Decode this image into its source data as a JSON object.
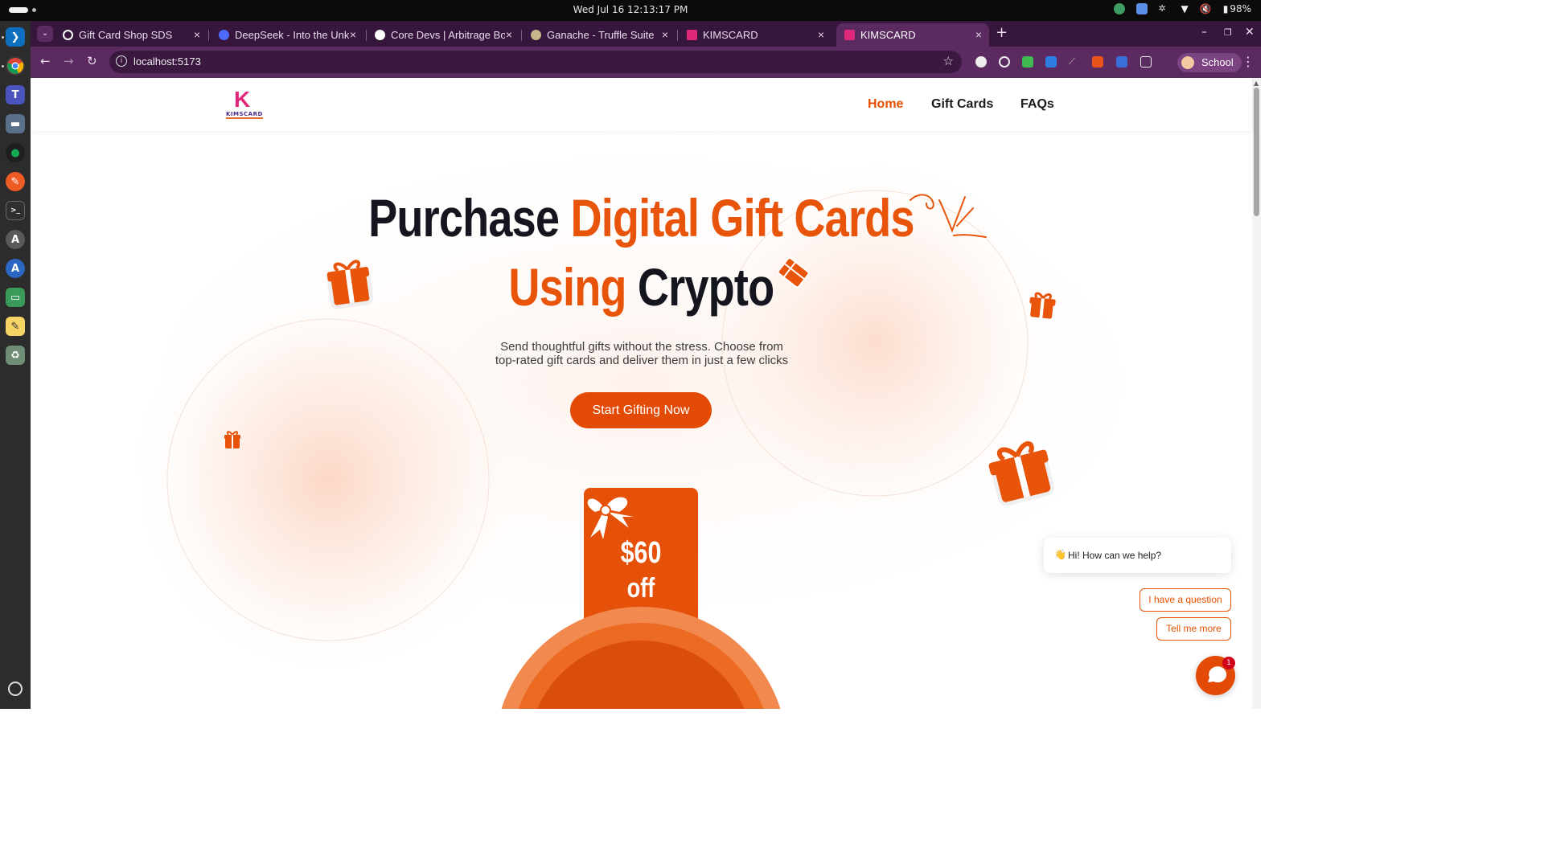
{
  "os": {
    "clock": "Wed Jul 16  12:13:17 PM",
    "battery": "98%"
  },
  "browser": {
    "tabs": [
      {
        "label": "Gift Card Shop SDS",
        "fav_color": "#ffffff"
      },
      {
        "label": "DeepSeek - Into the Unknown",
        "fav_color": "#4d6bfe"
      },
      {
        "label": "Core Devs | Arbitrage Bot",
        "fav_color": "#ffffff"
      },
      {
        "label": "Ganache - Truffle Suite",
        "fav_color": "#c8b58a"
      },
      {
        "label": "KIMSCARD",
        "fav_color": "#e0287a"
      },
      {
        "label": "KIMSCARD",
        "fav_color": "#e0287a"
      }
    ],
    "url": "localhost:5173",
    "profile": "School"
  },
  "site": {
    "logo_word": "KIMSCARD",
    "logo_letter": "K",
    "nav": [
      {
        "label": "Home"
      },
      {
        "label": "Gift Cards"
      },
      {
        "label": "FAQs"
      }
    ],
    "hero": {
      "line1_dark": "Purchase",
      "line1_orange": "Digital Gift Cards",
      "line2_orange": "Using",
      "line2_dark": "Crypto",
      "sub_line1": "Send thoughtful gifts without the stress. Choose from",
      "sub_line2": "top-rated gift cards and deliver them in just a few clicks",
      "cta": "Start Gifting Now"
    },
    "card": {
      "amount": "$60",
      "off": "off"
    }
  },
  "chat": {
    "wave": "👋",
    "greeting": "Hi! How can we help?",
    "options": [
      "I have a question",
      "Tell me more"
    ],
    "unread": "1"
  },
  "colors": {
    "brand": "#e8540a",
    "tab_bar": "#36163d",
    "toolbar": "#5a2a60"
  }
}
